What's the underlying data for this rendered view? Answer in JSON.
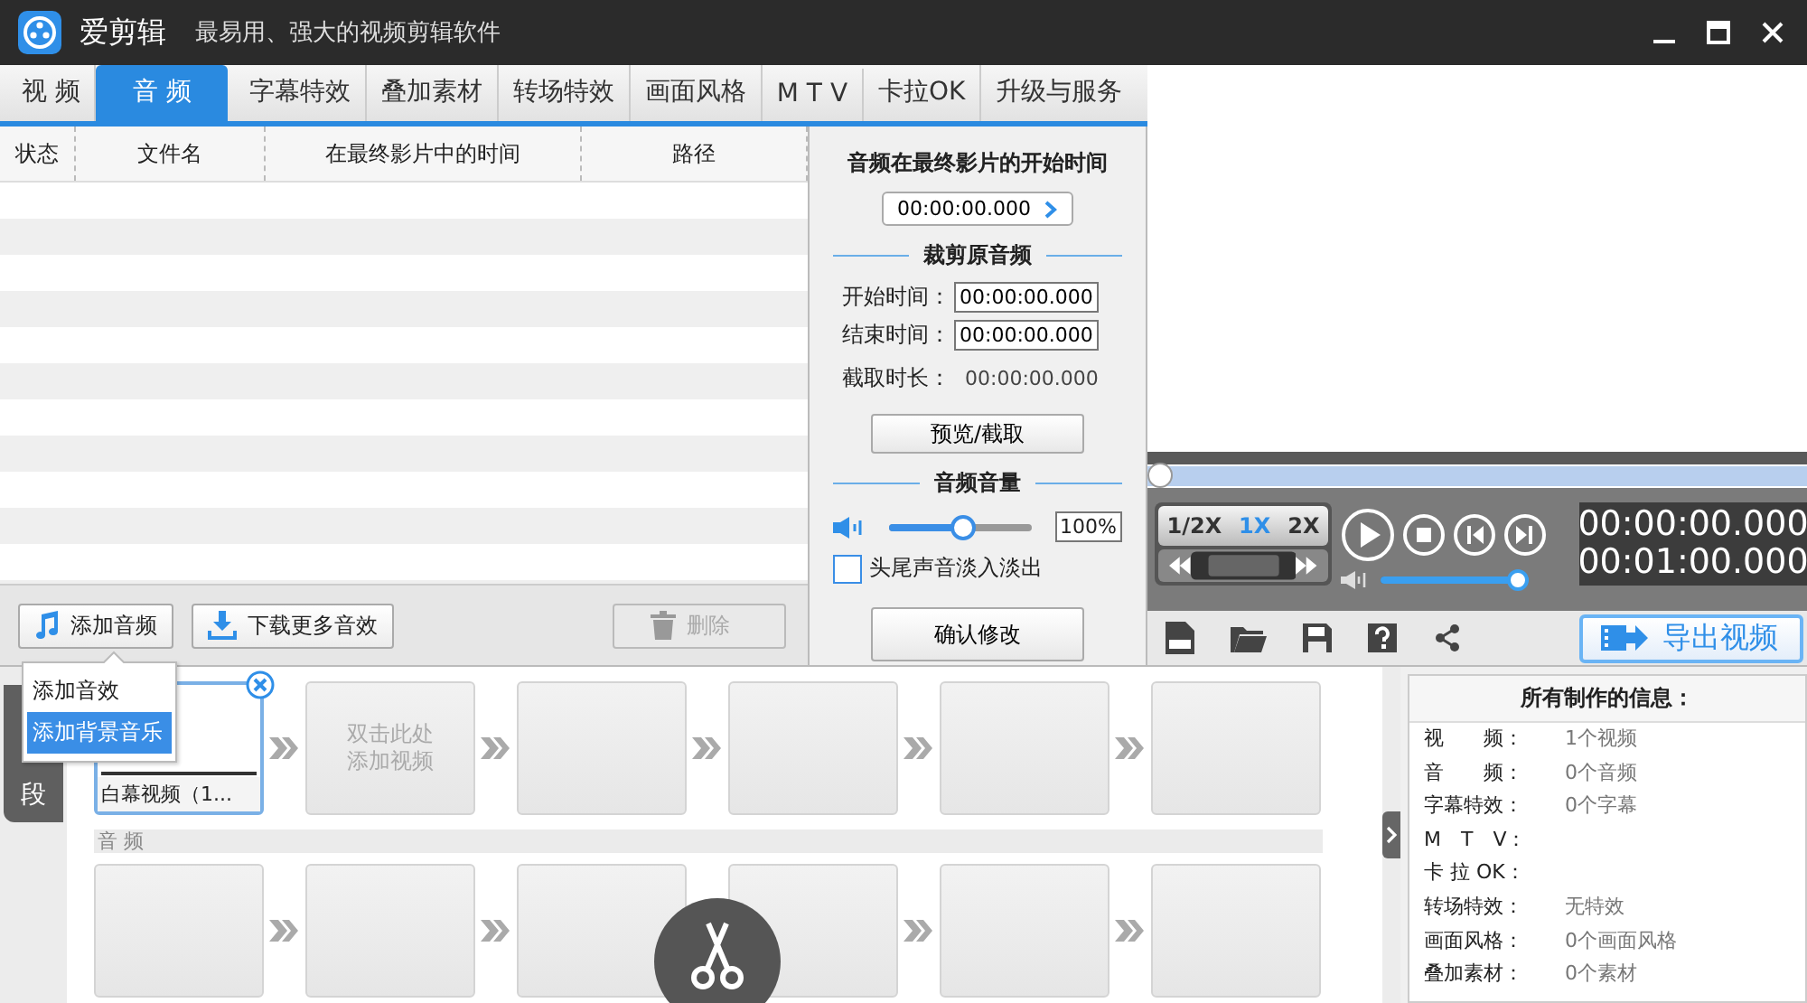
{
  "app": {
    "name": "爱剪辑",
    "slogan": "最易用、强大的视频剪辑软件"
  },
  "tabs": [
    {
      "label": "视 频",
      "selected": false
    },
    {
      "label": "音 频",
      "selected": true
    },
    {
      "label": "字幕特效",
      "selected": false
    },
    {
      "label": "叠加素材",
      "selected": false
    },
    {
      "label": "转场特效",
      "selected": false
    },
    {
      "label": "画面风格",
      "selected": false
    },
    {
      "label": "M T V",
      "selected": false
    },
    {
      "label": "卡拉OK",
      "selected": false
    },
    {
      "label": "升级与服务",
      "selected": false
    }
  ],
  "audio_table": {
    "columns": [
      "状态",
      "文件名",
      "在最终影片中的时间",
      "路径"
    ]
  },
  "audio_buttons": [
    {
      "kind": "add",
      "label": "添加音频",
      "disabled": false
    },
    {
      "kind": "download",
      "label": "下载更多音效",
      "disabled": false
    },
    {
      "kind": "delete",
      "label": "删除",
      "disabled": true
    }
  ],
  "add_menu": {
    "items": [
      {
        "label": "添加音效",
        "selected": false
      },
      {
        "label": "添加背景音乐",
        "selected": true
      }
    ]
  },
  "audio_settings": {
    "start_title": "音频在最终影片的开始时间",
    "start_time": "00:00:00.000",
    "trim_title": "裁剪原音频",
    "start_label": "开始时间：",
    "start_value": "00:00:00.000",
    "end_label": "结束时间：",
    "end_value": "00:00:00.000",
    "duration_label": "截取时长：",
    "duration_value": "00:00:00.000",
    "preview_button": "预览/截取",
    "volume_title": "音频音量",
    "volume": {
      "level": 0.52
    },
    "volume_reading": "100%",
    "fade": {
      "label": "头尾声音淡入淡出",
      "checked": false
    },
    "confirm_button": "确认修改"
  },
  "player": {
    "progress": {
      "level": 0
    },
    "speeds": [
      {
        "label": "1/2X",
        "selected": false
      },
      {
        "label": "1X",
        "selected": true
      },
      {
        "label": "2X",
        "selected": false
      }
    ],
    "volume": {
      "level": 1
    },
    "current_time": "00:00:00.000",
    "total_time": "00:01:00.000",
    "export_button": "导出视频"
  },
  "timeline": {
    "side_tab": "段",
    "video_clips": [
      {
        "kind": "clip",
        "caption": "白幕视频（1...",
        "selected": true
      },
      {
        "kind": "placeholder",
        "hint_lines": [
          "双击此处",
          "添加视频"
        ]
      },
      {
        "kind": "empty"
      },
      {
        "kind": "empty"
      },
      {
        "kind": "empty"
      },
      {
        "kind": "empty"
      }
    ],
    "audio_label": "音 频",
    "audio_clips": [
      {
        "kind": "empty"
      },
      {
        "kind": "empty"
      },
      {
        "kind": "empty"
      },
      {
        "kind": "empty"
      },
      {
        "kind": "empty"
      },
      {
        "kind": "empty"
      }
    ]
  },
  "info": {
    "title": "所有制作的信息：",
    "rows": [
      {
        "label": "视　　频：",
        "value": "1个视频"
      },
      {
        "label": "音　　频：",
        "value": "0个音频"
      },
      {
        "label": "字幕特效：",
        "value": "0个字幕"
      },
      {
        "label": "M　T　V："
      },
      {
        "label": "卡 拉 OK："
      },
      {
        "label": "转场特效：",
        "value": "无特效"
      },
      {
        "label": "画面风格：",
        "value": "0个画面风格"
      },
      {
        "label": "叠加素材：",
        "value": "0个素材"
      }
    ]
  }
}
